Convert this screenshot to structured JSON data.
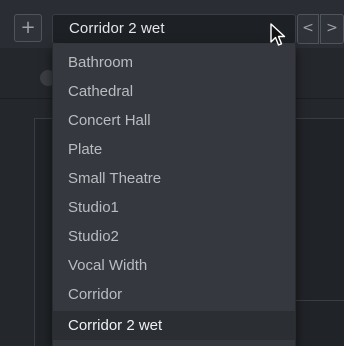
{
  "toolbar": {
    "add_label": "+",
    "preset_value": "Corridor 2 wet",
    "prev_label": "<",
    "next_label": ">"
  },
  "dropdown": {
    "items": [
      "Bathroom",
      "Cathedral",
      "Concert Hall",
      "Plate",
      "Small Theatre",
      "Studio1",
      "Studio2",
      "Vocal Width",
      "Corridor",
      "Corridor 2 wet"
    ],
    "selected": "Corridor 2 wet"
  },
  "icons": {
    "cursor": "arrow-cursor-icon"
  },
  "colors": {
    "background": "#2a2d33",
    "dropdown_bg": "#35383e",
    "selected_bg": "#2b2e33",
    "text": "#b9bcc1"
  }
}
